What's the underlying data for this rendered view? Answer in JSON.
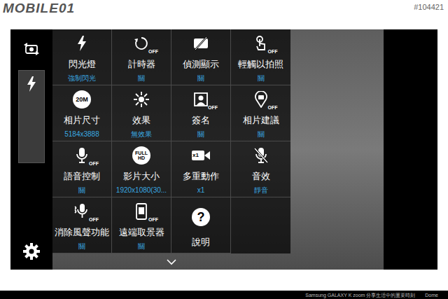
{
  "watermark": {
    "logo": "MOBILE01",
    "id": "#104421"
  },
  "rail": {
    "flash_selected": true
  },
  "settings": [
    {
      "label": "閃光燈",
      "value": "強制閃光"
    },
    {
      "label": "計時器",
      "value": "關",
      "badge": {
        "text": "OFF",
        "kind": "off"
      }
    },
    {
      "label": "偵測顯示",
      "value": "關"
    },
    {
      "label": "輕觸以拍照",
      "value": "關",
      "badge": {
        "text": "OFF",
        "kind": "off"
      }
    },
    {
      "label": "相片尺寸",
      "value": "5184x3888",
      "badge": {
        "text": "20M",
        "kind": "disc"
      }
    },
    {
      "label": "效果",
      "value": "無效果"
    },
    {
      "label": "簽名",
      "value": "關",
      "badge": {
        "text": "OFF",
        "kind": "off"
      }
    },
    {
      "label": "相片建議",
      "value": "關",
      "badge": {
        "text": "OFF",
        "kind": "off"
      }
    },
    {
      "label": "語音控制",
      "value": "關",
      "badge": {
        "text": "OFF",
        "kind": "off"
      }
    },
    {
      "label": "影片大小",
      "value": "1920x1080(30...",
      "badge": {
        "text": "FULL HD",
        "kind": "disc"
      }
    },
    {
      "label": "多重動作",
      "value": "x1",
      "badge": {
        "text": "x1",
        "kind": "count"
      }
    },
    {
      "label": "音效",
      "value": "靜音"
    },
    {
      "label": "消除風聲功能",
      "value": "關",
      "badge": {
        "text": "OFF",
        "kind": "off"
      }
    },
    {
      "label": "遠端取景器",
      "value": "關",
      "badge": {
        "text": "OFF",
        "kind": "off"
      }
    },
    {
      "label": "說明",
      "badge": {
        "text": "?",
        "kind": "disc"
      }
    }
  ],
  "caption": {
    "text": "Samsung GALAXY K zoom 分享生活中的重要時刻",
    "author": "Dome"
  }
}
